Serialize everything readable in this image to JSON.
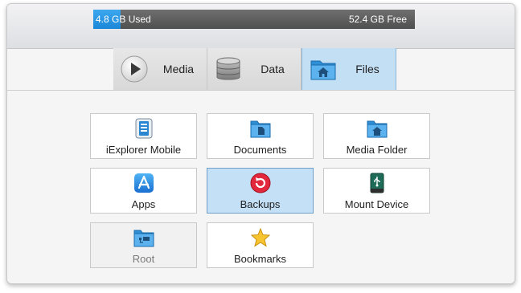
{
  "storage": {
    "used_label": "4.8 GB Used",
    "free_label": "52.4 GB Free",
    "used_fraction": 0.084
  },
  "tabs": [
    {
      "label": "Media",
      "icon": "play-icon",
      "active": false
    },
    {
      "label": "Data",
      "icon": "database-icon",
      "active": false
    },
    {
      "label": "Files",
      "icon": "home-folder-icon",
      "active": true
    }
  ],
  "tiles": [
    {
      "label": "iExplorer Mobile",
      "icon": "iexplorer-mobile-icon",
      "state": "normal"
    },
    {
      "label": "Documents",
      "icon": "document-folder-icon",
      "state": "normal"
    },
    {
      "label": "Media Folder",
      "icon": "home-folder-icon",
      "state": "normal"
    },
    {
      "label": "Apps",
      "icon": "app-store-icon",
      "state": "normal"
    },
    {
      "label": "Backups",
      "icon": "backup-icon",
      "state": "selected"
    },
    {
      "label": "Mount Device",
      "icon": "usb-drive-icon",
      "state": "normal"
    },
    {
      "label": "Root",
      "icon": "root-folder-icon",
      "state": "disabled"
    },
    {
      "label": "Bookmarks",
      "icon": "star-icon",
      "state": "normal"
    }
  ],
  "colors": {
    "accent": "#1b86d6",
    "selected_bg": "#c4e0f6",
    "used_bar": "#3da8f0",
    "free_bar": "#5a5a5a"
  }
}
